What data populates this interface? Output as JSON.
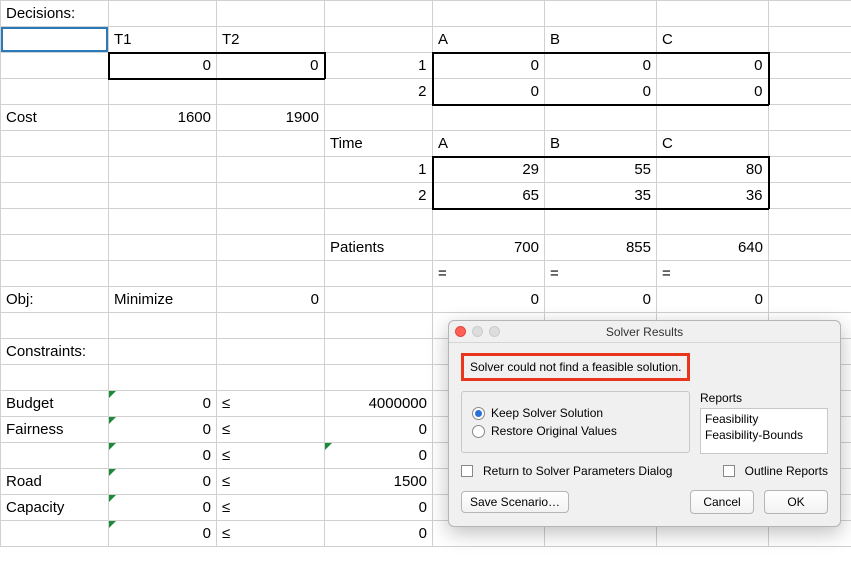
{
  "hdr": {
    "decisions": "Decisions:",
    "T1": "T1",
    "T2": "T2",
    "A": "A",
    "B": "B",
    "C": "C"
  },
  "r2": {
    "t1": "0",
    "t2": "0",
    "n1": "1",
    "a": "0",
    "b": "0",
    "c": "0"
  },
  "r3": {
    "n2": "2",
    "a": "0",
    "b": "0",
    "c": "0"
  },
  "r4": {
    "cost": "Cost",
    "t1": "1600",
    "t2": "1900"
  },
  "r5": {
    "time": "Time",
    "A": "A",
    "B": "B",
    "C": "C"
  },
  "r6": {
    "n": "1",
    "a": "29",
    "b": "55",
    "c": "80"
  },
  "r7": {
    "n": "2",
    "a": "65",
    "b": "35",
    "c": "36"
  },
  "r9": {
    "patients": "Patients",
    "a": "700",
    "b": "855",
    "c": "640"
  },
  "r10": {
    "eq": "="
  },
  "r11": {
    "obj": "Obj:",
    "min": "Minimize",
    "z": "0",
    "a": "0",
    "b": "0",
    "c": "0"
  },
  "r13": {
    "con": "Constraints:"
  },
  "r15": {
    "lbl": "Budget",
    "v": "0",
    "le": "≤",
    "rhs": "4000000"
  },
  "r16": {
    "lbl": "Fairness",
    "v": "0",
    "le": "≤",
    "rhs": "0"
  },
  "r17": {
    "lbl": "",
    "v": "0",
    "le": "≤",
    "rhs": "0"
  },
  "r18": {
    "lbl": "Road",
    "v": "0",
    "le": "≤",
    "rhs": "1500"
  },
  "r19": {
    "lbl": "Capacity",
    "v": "0",
    "le": "≤",
    "rhs": "0"
  },
  "r20": {
    "lbl": "",
    "v": "0",
    "le": "≤",
    "rhs": "0"
  },
  "dlg": {
    "title": "Solver Results",
    "msg": "Solver could not find a feasible solution.",
    "keep": "Keep Solver Solution",
    "restore": "Restore Original Values",
    "reports_label": "Reports",
    "report1": "Feasibility",
    "report2": "Feasibility-Bounds",
    "return": "Return to Solver Parameters Dialog",
    "outline": "Outline Reports",
    "save": "Save Scenario…",
    "cancel": "Cancel",
    "ok": "OK"
  },
  "chart_data": {
    "type": "table",
    "title": "Linear Program Setup",
    "decision_vars": {
      "T1": 0,
      "T2": 0
    },
    "assignments": {
      "1": {
        "A": 0,
        "B": 0,
        "C": 0
      },
      "2": {
        "A": 0,
        "B": 0,
        "C": 0
      }
    },
    "cost": {
      "T1": 1600,
      "T2": 1900
    },
    "time": {
      "1": {
        "A": 29,
        "B": 55,
        "C": 80
      },
      "2": {
        "A": 65,
        "B": 35,
        "C": 36
      }
    },
    "patients": {
      "A": 700,
      "B": 855,
      "C": 640
    },
    "patients_relation": "=",
    "objective": {
      "sense": "Minimize",
      "value": 0,
      "by_col": {
        "A": 0,
        "B": 0,
        "C": 0
      }
    },
    "constraints": [
      {
        "name": "Budget",
        "lhs": 0,
        "op": "<=",
        "rhs": 4000000
      },
      {
        "name": "Fairness",
        "lhs": 0,
        "op": "<=",
        "rhs": 0
      },
      {
        "name": "",
        "lhs": 0,
        "op": "<=",
        "rhs": 0
      },
      {
        "name": "Road",
        "lhs": 0,
        "op": "<=",
        "rhs": 1500
      },
      {
        "name": "Capacity",
        "lhs": 0,
        "op": "<=",
        "rhs": 0
      },
      {
        "name": "",
        "lhs": 0,
        "op": "<=",
        "rhs": 0
      }
    ]
  }
}
